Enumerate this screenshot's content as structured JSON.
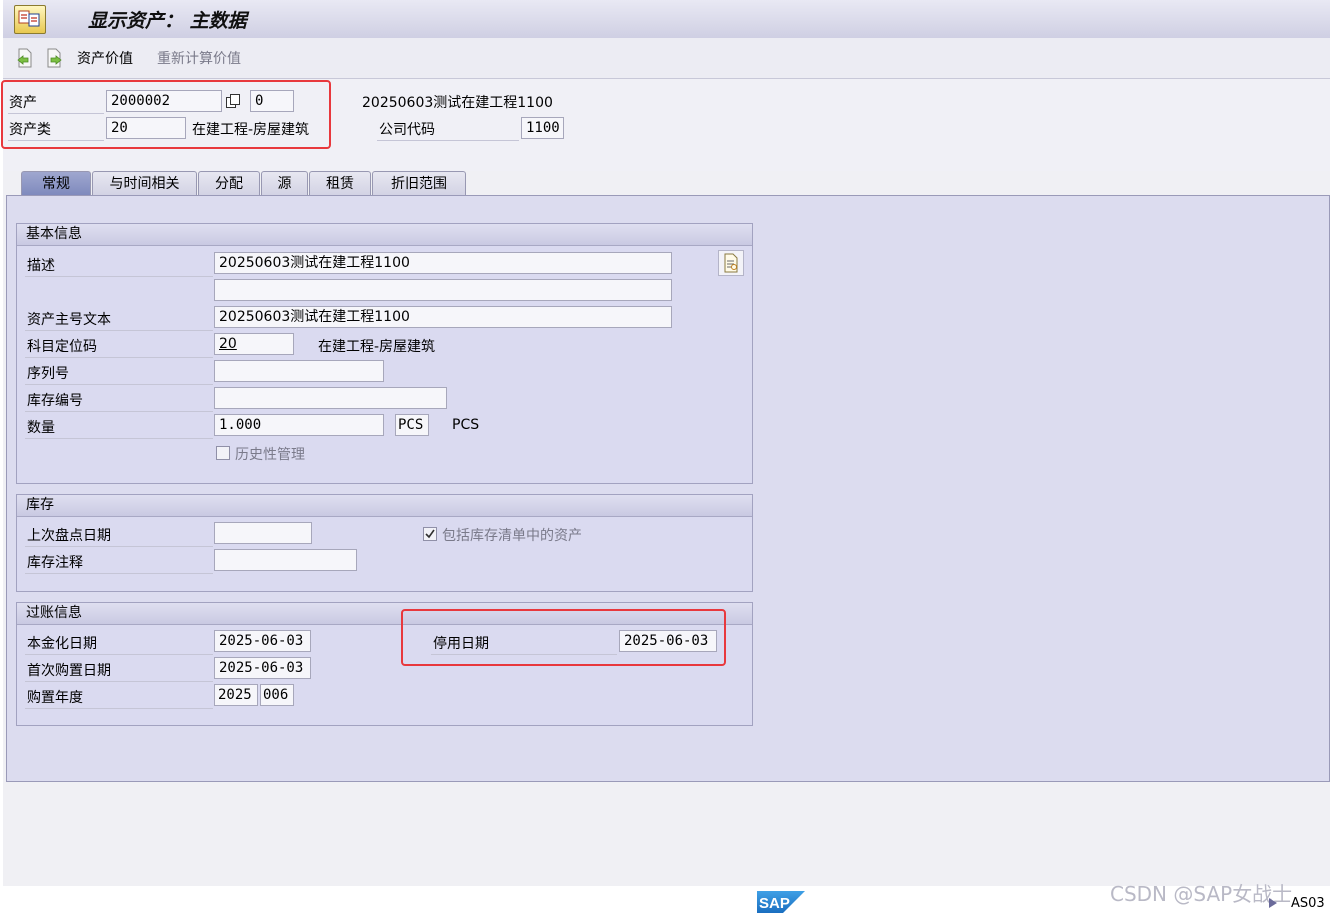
{
  "window": {
    "title": "显示资产： 主数据"
  },
  "toolbar": {
    "asset_value": "资产价值",
    "recalc_value": "重新计算价值"
  },
  "header": {
    "asset_label": "资产",
    "asset_number": "2000002",
    "sub_number": "0",
    "asset_description": "20250603测试在建工程1100",
    "asset_class_label": "资产类",
    "asset_class": "20",
    "asset_class_text": "在建工程-房屋建筑",
    "company_code_label": "公司代码",
    "company_code": "1100"
  },
  "tabs": [
    {
      "label": "常规",
      "active": true
    },
    {
      "label": "与时间相关"
    },
    {
      "label": "分配"
    },
    {
      "label": "源"
    },
    {
      "label": "租赁"
    },
    {
      "label": "折旧范围"
    }
  ],
  "general": {
    "title": "基本信息",
    "description_label": "描述",
    "description": "20250603测试在建工程1100",
    "description2": "",
    "main_text_label": "资产主号文本",
    "main_text": "20250603测试在建工程1100",
    "account_det_label": "科目定位码",
    "account_det": "20",
    "account_det_text": "在建工程-房屋建筑",
    "serial_label": "序列号",
    "serial": "",
    "inventory_no_label": "库存编号",
    "inventory_no": "",
    "quantity_label": "数量",
    "quantity": "1.000",
    "unit": "PCS",
    "unit_text": "PCS",
    "history_label": "历史性管理"
  },
  "inventory": {
    "title": "库存",
    "last_date_label": "上次盘点日期",
    "last_date": "",
    "note_label": "库存注释",
    "note": "",
    "include_label": "包括库存清单中的资产",
    "include_checked": true
  },
  "posting": {
    "title": "过账信息",
    "cap_date_label": "本金化日期",
    "cap_date": "2025-06-03",
    "first_acq_label": "首次购置日期",
    "first_acq": "2025-06-03",
    "acq_year_label": "购置年度",
    "acq_year": "2025",
    "acq_period": "006",
    "deact_label": "停用日期",
    "deact_date": "2025-06-03"
  },
  "status": {
    "sap_logo": "SAP",
    "tcode": "AS03",
    "watermark": "CSDN @SAP女战士"
  },
  "colors": {
    "highlight": "#e8383d",
    "panel": "#dcdcef",
    "active_tab": "#8a94c4"
  }
}
